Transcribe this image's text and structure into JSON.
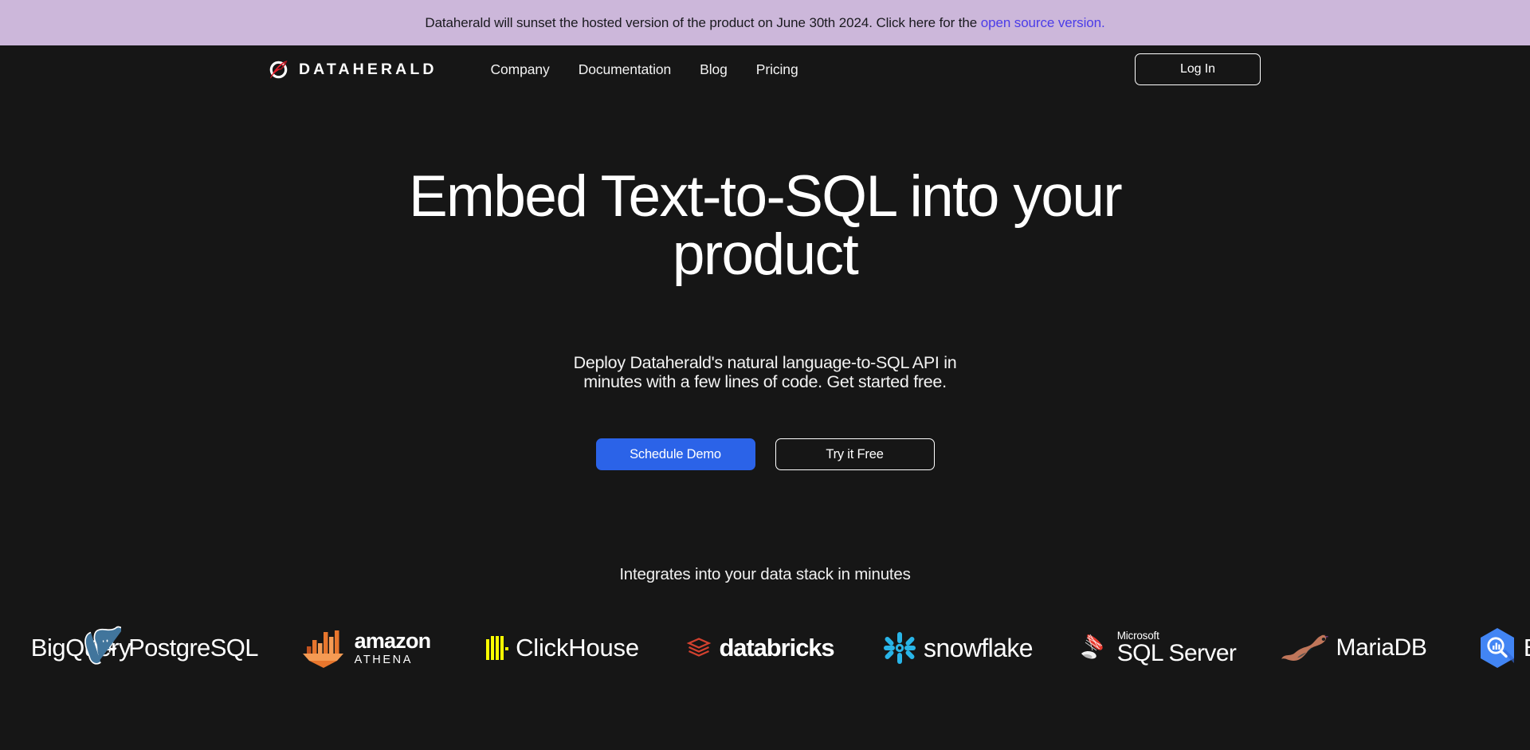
{
  "banner": {
    "text_before": "Dataherald will sunset the hosted version of the product on June 30th 2024. Click here for the ",
    "link_label": "open source version.",
    "background_color": "#ccb7da",
    "link_color": "#4b3ce8"
  },
  "header": {
    "brand_name": "DATAHERALD",
    "brand_icon": "feather-logo-icon",
    "nav": [
      {
        "label": "Company"
      },
      {
        "label": "Documentation"
      },
      {
        "label": "Blog"
      },
      {
        "label": "Pricing"
      }
    ],
    "login_label": "Log In"
  },
  "hero": {
    "title": "Embed Text-to-SQL into your product",
    "subtitle": "Deploy Dataherald's natural language-to-SQL API in minutes with a few lines of code. Get started free.",
    "primary_cta": "Schedule Demo",
    "secondary_cta": "Try it Free",
    "primary_cta_color": "#2b63e8"
  },
  "integrations": {
    "heading": "Integrates into your data stack in minutes",
    "logos": [
      {
        "name": "bigquery-logo",
        "word": "BigQuery",
        "partial": true,
        "color": "#4285f4"
      },
      {
        "name": "postgresql-logo",
        "word": "PostgreSQL",
        "color": "#41759c"
      },
      {
        "name": "amazon-athena-logo",
        "word_top": "amazon",
        "word_bottom": "ATHENA",
        "color": "#e8762d"
      },
      {
        "name": "clickhouse-logo",
        "word": "ClickHouse",
        "color": "#faff00"
      },
      {
        "name": "databricks-logo",
        "word": "databricks",
        "color": "#d3412f"
      },
      {
        "name": "snowflake-logo",
        "word": "snowflake",
        "color": "#29b5e8"
      },
      {
        "name": "microsoft-sql-server-logo",
        "word_top": "Microsoft",
        "word_bottom": "SQL Server",
        "color": "#e8382d"
      },
      {
        "name": "mariadb-logo",
        "word": "MariaDB",
        "color": "#c0765a"
      },
      {
        "name": "bigquery-logo",
        "word": "BigQuery",
        "color": "#4285f4"
      }
    ]
  },
  "page": {
    "background_color": "#161616"
  }
}
